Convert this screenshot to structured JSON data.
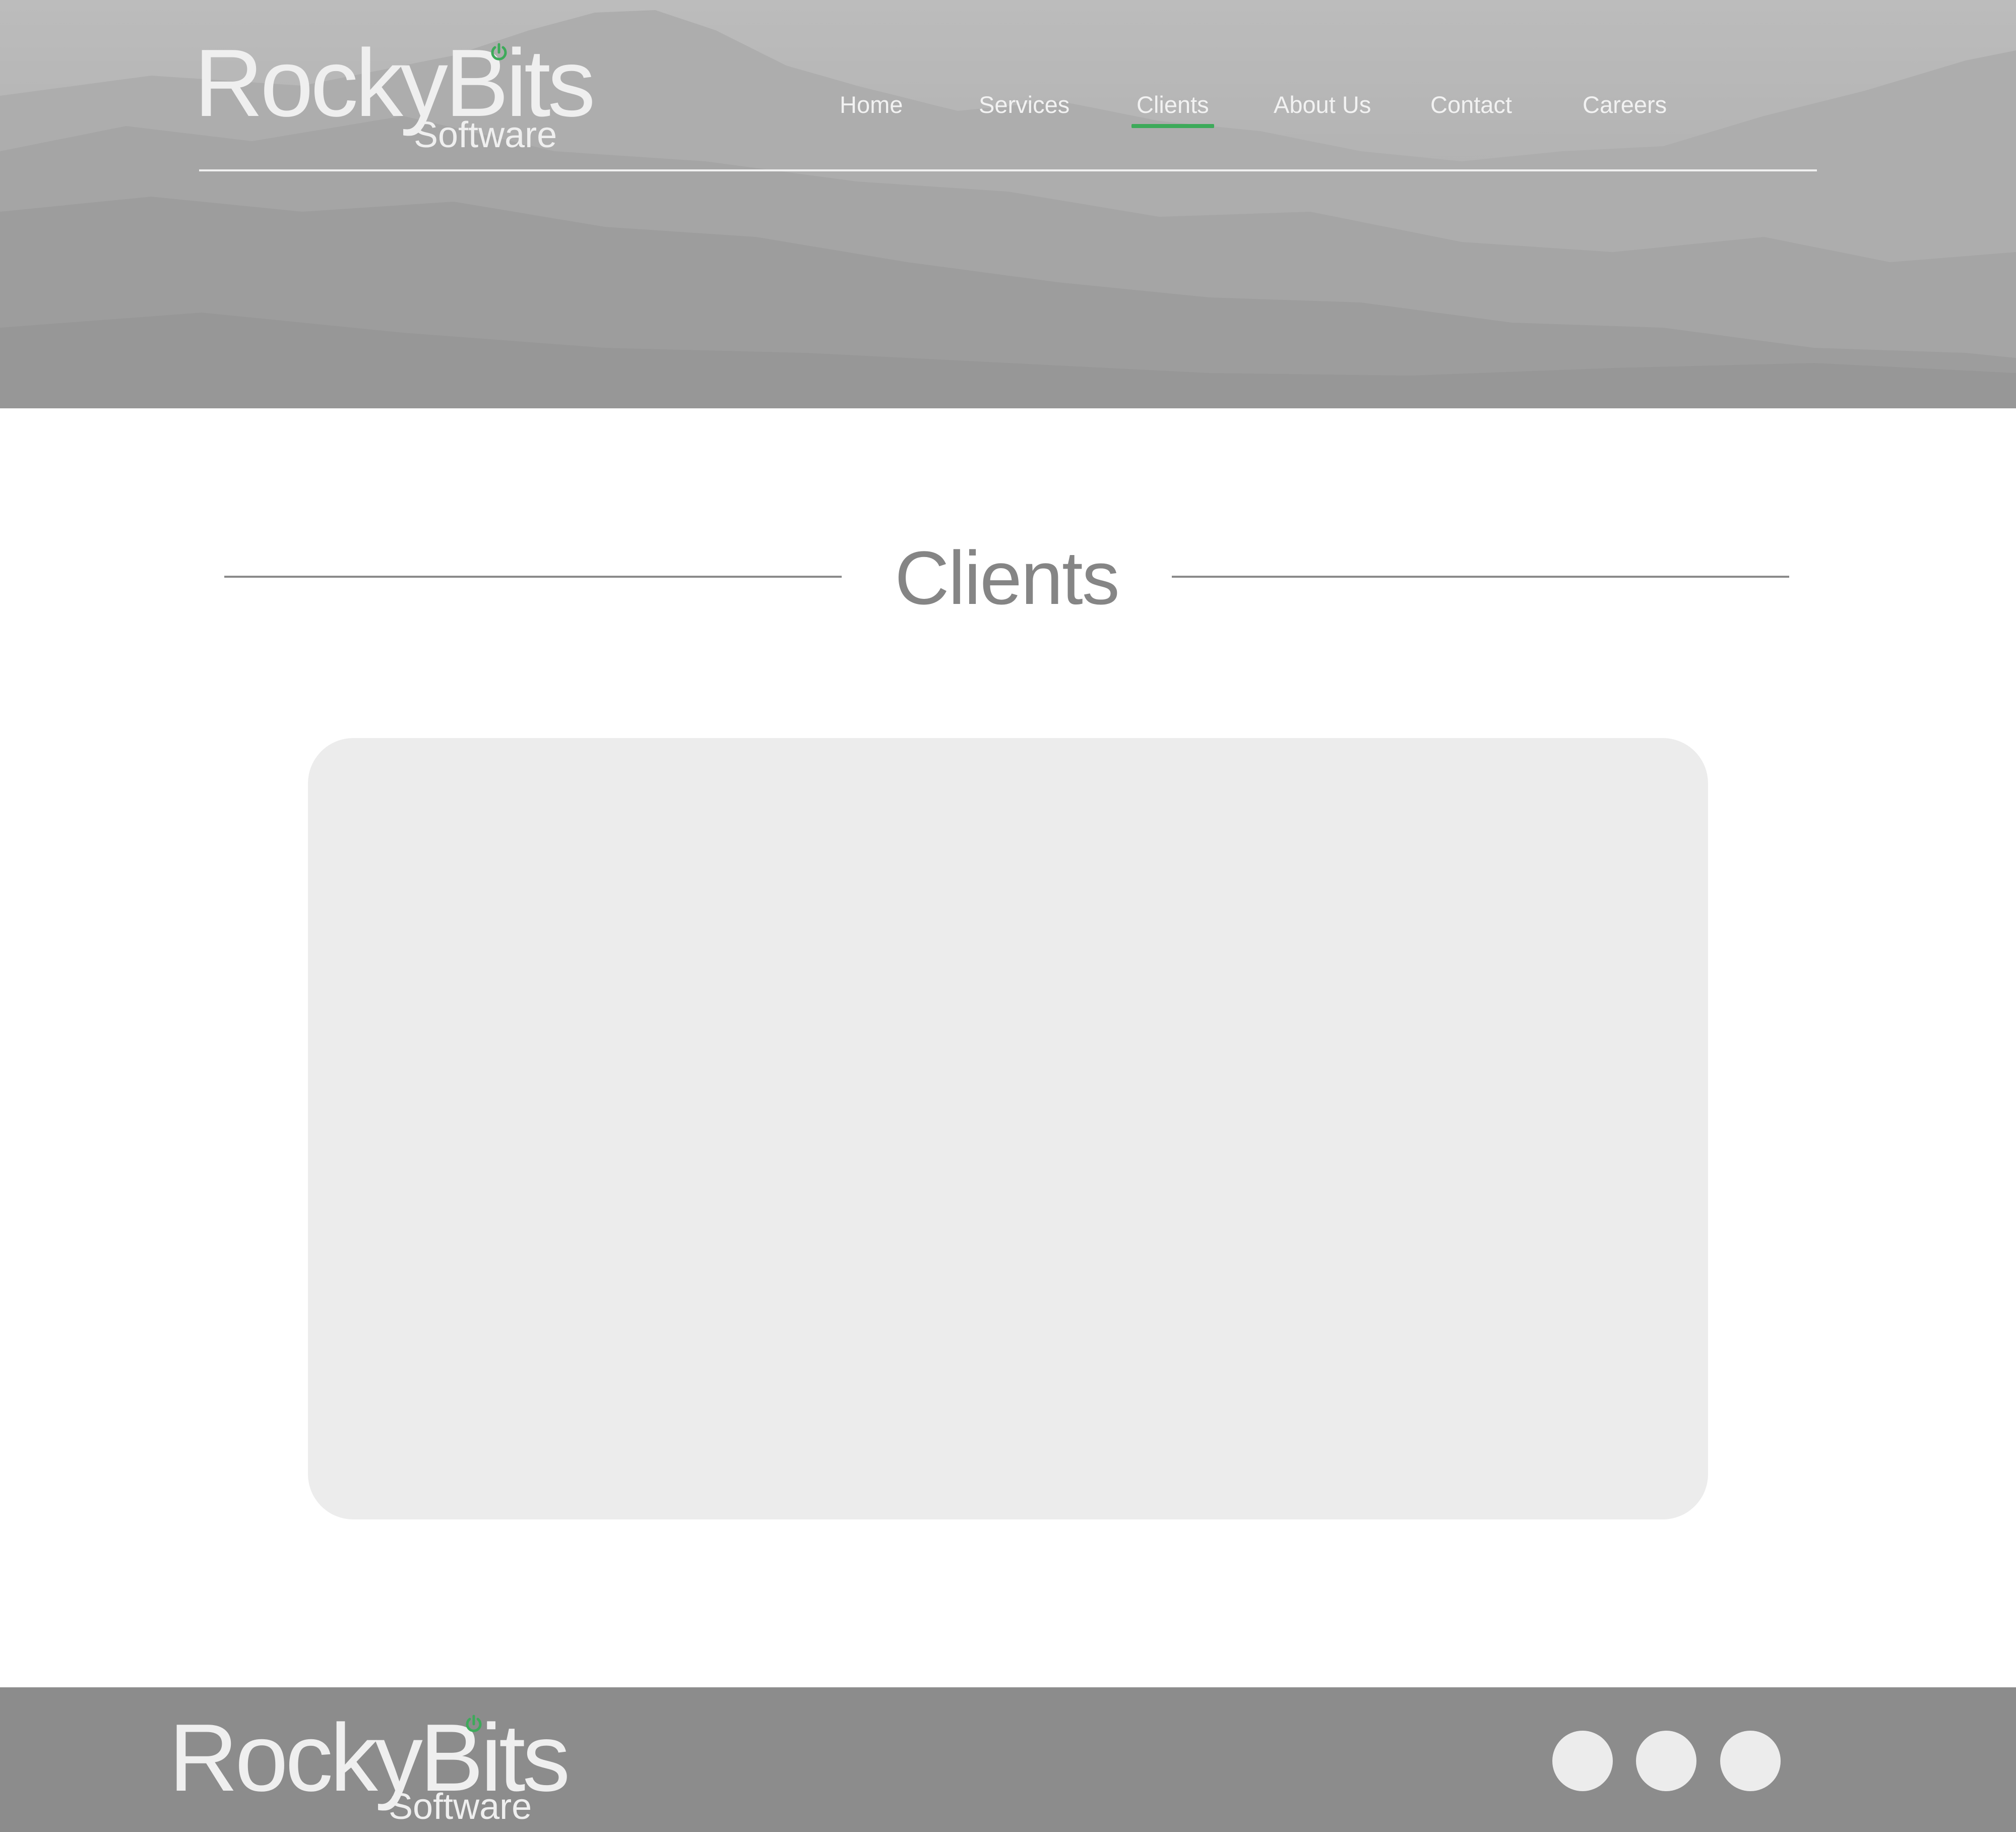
{
  "header": {
    "logo": {
      "brand": "RockyBits",
      "tagline": "Software",
      "icon": "power-icon",
      "icon_color": "#3daa5a"
    },
    "nav": [
      {
        "label": "Home",
        "active": false
      },
      {
        "label": "Services",
        "active": false
      },
      {
        "label": "Clients",
        "active": true
      },
      {
        "label": "About Us",
        "active": false
      },
      {
        "label": "Contact",
        "active": false
      },
      {
        "label": "Careers",
        "active": false
      }
    ],
    "accent_color": "#3daa5a"
  },
  "main": {
    "title": "Clients"
  },
  "footer": {
    "logo": {
      "brand": "RockyBits",
      "tagline": "Software",
      "icon": "power-icon"
    },
    "social_icons": [
      "social-icon-1",
      "social-icon-2",
      "social-icon-3"
    ]
  }
}
